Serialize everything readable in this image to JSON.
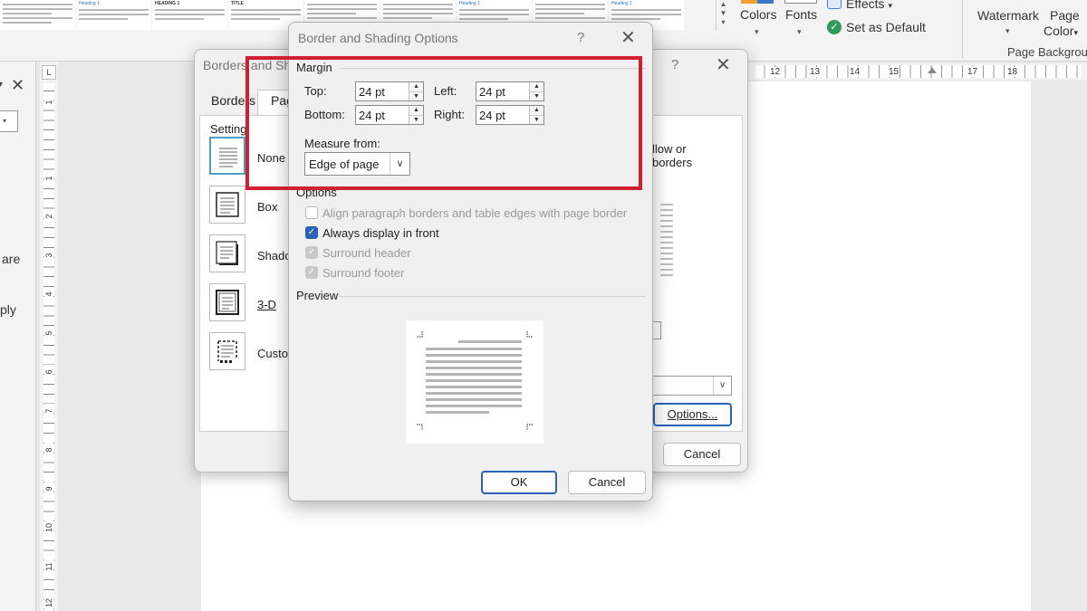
{
  "ribbon": {
    "colors_label": "Colors",
    "fonts_label": "Fonts",
    "effects_label": "Effects",
    "effects_caret": "▾",
    "set_default_label": "Set as Default",
    "watermark_label": "Watermark",
    "page_color_label_1": "Page",
    "page_color_label_2": "Color",
    "page_color_caret": "▾",
    "group_label": "Page Backgrou",
    "caret": "▾",
    "gallery_heading_1": "Heading 1",
    "gallery_heading_caps": "HEADING 1",
    "gallery_title": "TITLE"
  },
  "nav_pane": {
    "close_glyph": "✕",
    "caret_glyph": "▾",
    "dropdown_glyph": "▾",
    "frag_are": "are",
    "frag_ply": "ply"
  },
  "ruler": {
    "tab_glyph": "L",
    "h_numbers": [
      "12",
      "13",
      "14",
      "15",
      "17",
      "18"
    ],
    "v_numbers": [
      "1",
      "1",
      "2",
      "3",
      "4",
      "5",
      "6",
      "7",
      "8",
      "9",
      "10",
      "11",
      "12"
    ]
  },
  "back_dialog": {
    "title": "Borders and Sha",
    "help_glyph": "?",
    "close_glyph": "✕",
    "tab_borders": "Borders",
    "tab_page": "Pag",
    "setting_title": "Setting:",
    "settings": [
      "None",
      "Box",
      "Shado",
      "3-D",
      "Custo"
    ],
    "right_text_1": "llow or",
    "right_text_2": "borders",
    "options_button": "Options...",
    "cancel_button": "Cancel",
    "select_arrow": "∨"
  },
  "front_dialog": {
    "title": "Border and Shading Options",
    "help_glyph": "?",
    "close_glyph": "✕",
    "margin_label": "Margin",
    "top_label": "Top:",
    "top_value": "24 pt",
    "bottom_label": "Bottom:",
    "bottom_value": "24 pt",
    "left_label": "Left:",
    "left_value": "24 pt",
    "right_label": "Right:",
    "right_value": "24 pt",
    "spin_up": "▲",
    "spin_down": "▼",
    "measure_label": "Measure from:",
    "measure_value": "Edge of page",
    "measure_arrow": "∨",
    "options_label": "Options",
    "options": [
      {
        "label": "Align paragraph borders and table edges with page border",
        "checked": false,
        "disabled": false
      },
      {
        "label": "Always display in front",
        "checked": true,
        "disabled": false
      },
      {
        "label": "Surround header",
        "checked": true,
        "disabled": true
      },
      {
        "label": "Surround footer",
        "checked": true,
        "disabled": true
      }
    ],
    "check_glyph": "✓",
    "preview_label": "Preview",
    "ok_button": "OK",
    "cancel_button": "Cancel"
  },
  "colors": {
    "accent": "#2a62b8",
    "highlight": "#d11f2f"
  }
}
